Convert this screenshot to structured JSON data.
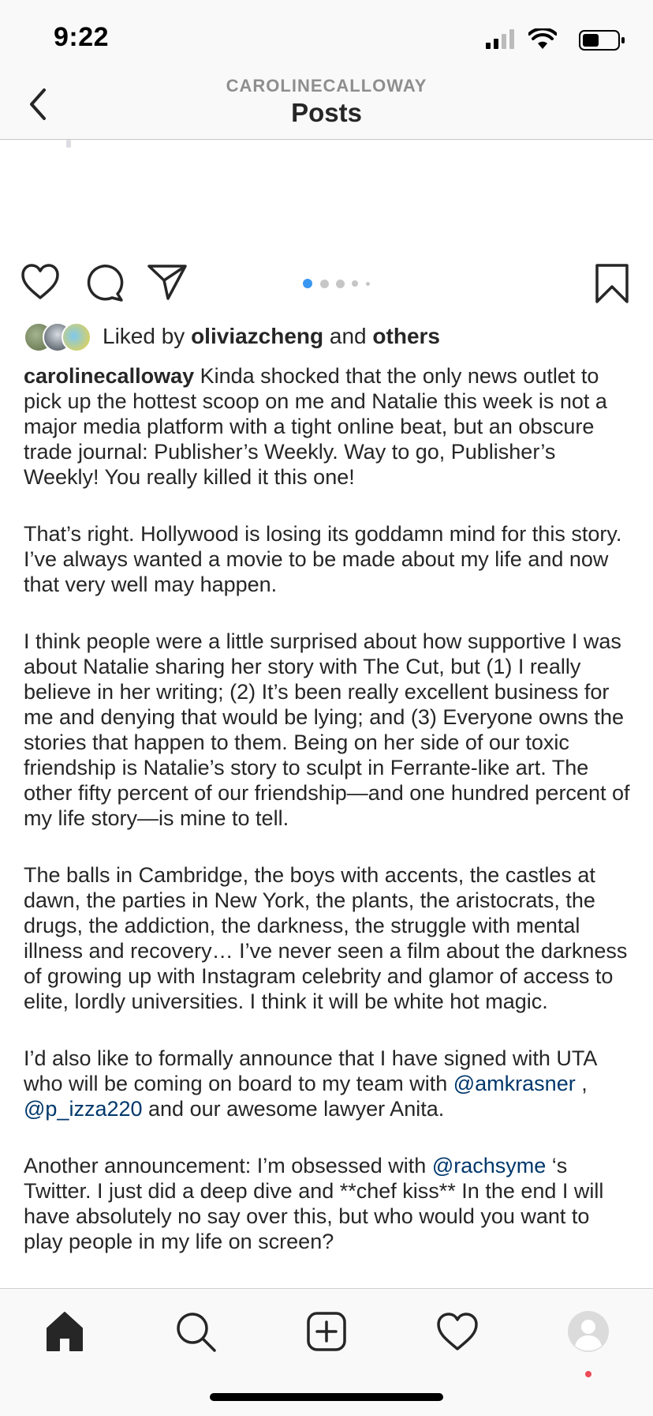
{
  "status_bar": {
    "time": "9:22",
    "icons": [
      "signal-icon",
      "wifi-icon",
      "battery-icon"
    ]
  },
  "header": {
    "username": "CAROLINECALLOWAY",
    "title": "Posts",
    "back_icon": "chevron-left-icon"
  },
  "actions": {
    "icons": [
      "heart-icon",
      "comment-icon",
      "send-icon",
      "bookmark-icon"
    ],
    "carousel": {
      "total_dots": 5,
      "active_index": 0,
      "active_color": "#3897f0"
    }
  },
  "likes": {
    "prefix": "Liked by",
    "user": "oliviazcheng",
    "conjunction": "and",
    "others": "others"
  },
  "caption": {
    "username": "carolinecalloway",
    "p1": "Kinda shocked that the only news outlet to pick up the hottest scoop on me and Natalie this week is not a major media platform with a tight online beat, but an obscure trade journal: Publisher’s Weekly. Way to go, Publisher’s Weekly! You really killed it this one!",
    "p2": "That’s right. Hollywood is losing its goddamn mind for this story. I’ve always wanted a movie to be made about my life and now that very well may happen.",
    "p3": "I think people were a little surprised about how supportive I was about Natalie sharing her story with The Cut, but (1) I really believe in her writing; (2) It’s been really excellent business for me and denying that would be lying; and (3) Everyone owns the stories that happen to them. Being on her side of our toxic friendship is Natalie’s story to sculpt in Ferrante-like art. The other fifty percent of our friendship—and one hundred percent of my life story—is mine to tell.",
    "p4": "The balls in Cambridge, the boys with accents, the castles at dawn, the parties in New York, the plants, the aristocrats, the drugs, the addiction, the darkness, the struggle with mental illness and recovery… I’ve never seen a film about the darkness of growing up with Instagram celebrity and glamor of access to elite, lordly universities. I think it will be white hot magic.",
    "p5_start": "I’d also like to formally announce that I have signed with UTA who will be coming on board to my team with ",
    "p5_mention1": "@amkrasner",
    "p5_sep": " , ",
    "p5_mention2": "@p_izza220",
    "p5_end": " and our awesome lawyer Anita.",
    "p6_start": "Another announcement: I’m obsessed with ",
    "p6_mention": "@rachsyme",
    "p6_end": " ‘s Twitter. I just did a deep dive and **chef kiss** In the end I will have absolutely no say over this, but who would you want to play people in my life on screen?"
  },
  "tab_bar": {
    "icons": [
      "home-icon",
      "search-icon",
      "add-post-icon",
      "activity-heart-icon",
      "profile-avatar-icon"
    ],
    "notification_color": "#ed4956"
  },
  "colors": {
    "text": "#262626",
    "mention": "#00376b",
    "muted": "#8e8e8e"
  }
}
